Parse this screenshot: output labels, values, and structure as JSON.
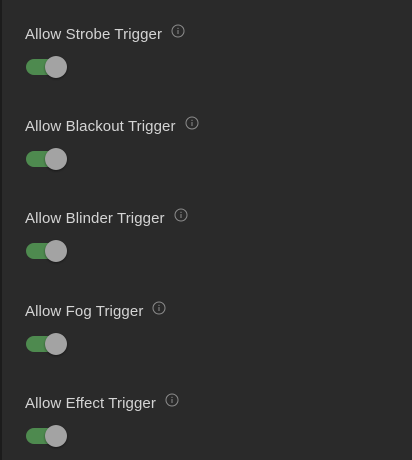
{
  "settings": [
    {
      "label": "Allow Strobe Trigger",
      "icon": "info-icon",
      "toggle_on": true
    },
    {
      "label": "Allow Blackout Trigger",
      "icon": "info-icon",
      "toggle_on": true
    },
    {
      "label": "Allow Blinder Trigger",
      "icon": "info-icon",
      "toggle_on": true
    },
    {
      "label": "Allow Fog Trigger",
      "icon": "info-icon",
      "toggle_on": true
    },
    {
      "label": "Allow Effect Trigger",
      "icon": "info-icon",
      "toggle_on": true
    }
  ],
  "colors": {
    "background": "#2a2a2a",
    "label": "#d4d4d4",
    "toggle_track_on": "#4e8a4f",
    "toggle_thumb": "#a3a3a3",
    "info_icon": "#8c8c8c"
  }
}
